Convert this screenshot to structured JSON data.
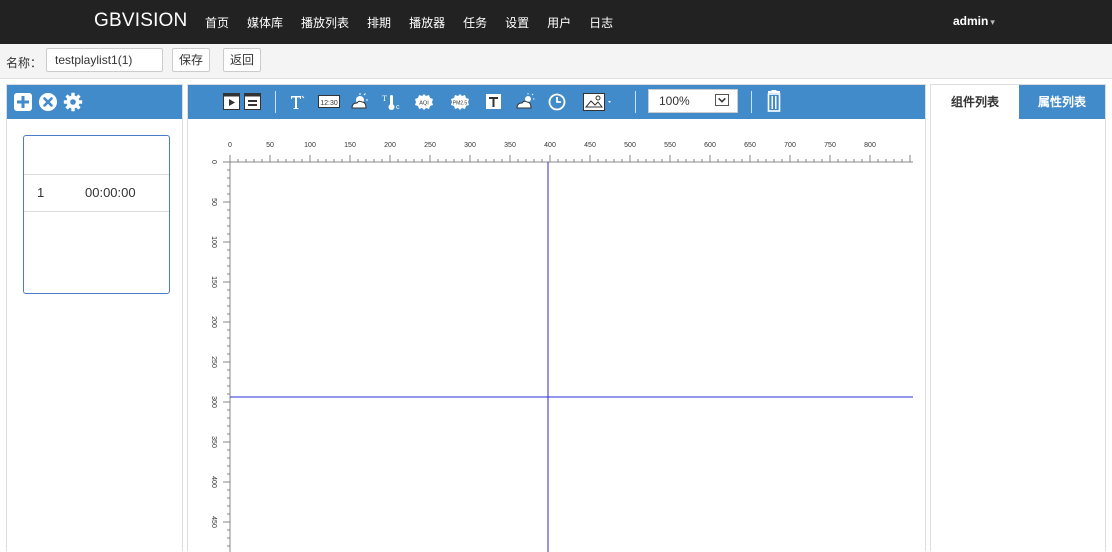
{
  "brand": "GBVISION",
  "nav": [
    "首页",
    "媒体库",
    "播放列表",
    "排期",
    "播放器",
    "任务",
    "设置",
    "用户",
    "日志"
  ],
  "user": {
    "name": "admin",
    "caret": "▾"
  },
  "namebar": {
    "label": "名称：",
    "value": "testplaylist1(1)",
    "save": "保存",
    "back": "返回"
  },
  "left_icons": [
    "plus-icon",
    "close-circle-icon",
    "gear-icon"
  ],
  "playlist": {
    "index": "1",
    "time": "00:00:00"
  },
  "toolbar_icons": [
    "video-icon",
    "text-list-icon",
    "text-icon",
    "clock-digital-icon",
    "weather-icon",
    "temperature-icon",
    "aqi-icon",
    "pm25-icon",
    "text-box-icon",
    "weather-cloud-icon",
    "clock-icon",
    "image-icon",
    "delete-icon"
  ],
  "zoom": {
    "value": "100%"
  },
  "ruler": {
    "top": [
      "0",
      "50",
      "100",
      "150",
      "200",
      "250",
      "300",
      "350",
      "400",
      "450",
      "500",
      "550",
      "600",
      "650",
      "700",
      "750",
      "800"
    ],
    "left": [
      "0",
      "50",
      "100",
      "150",
      "200",
      "250",
      "300",
      "350",
      "400",
      "450"
    ]
  },
  "right_tabs": {
    "components": "组件列表",
    "properties": "属性列表"
  },
  "colors": {
    "topbar": "#222222",
    "accent": "#428bca",
    "crosshair": "#2b2bd6"
  }
}
